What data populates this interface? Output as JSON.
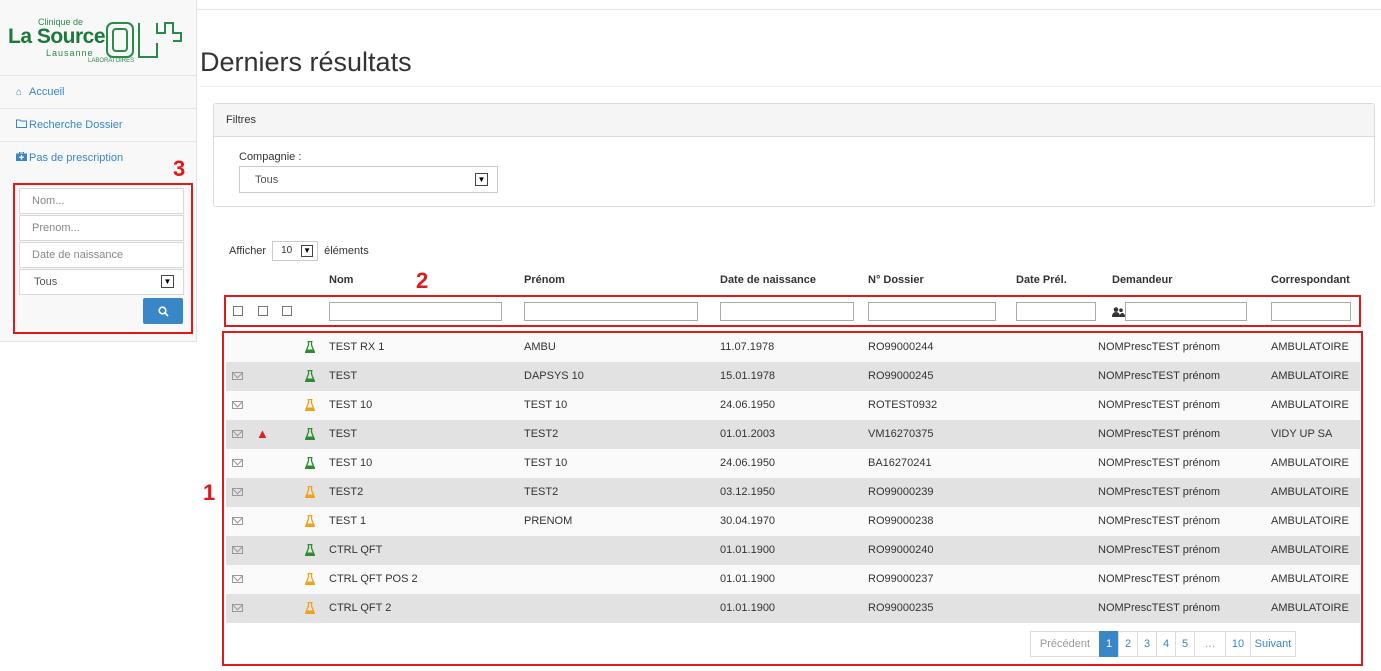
{
  "logo": {
    "line1": "Clinique de",
    "line2": "La Source",
    "line3": "Lausanne",
    "sub": "LABORATOIRES"
  },
  "sidebar": {
    "items": [
      {
        "label": "Accueil",
        "icon": "home-icon"
      },
      {
        "label": "Recherche Dossier",
        "icon": "folder-open-icon"
      },
      {
        "label": "Pas de prescription",
        "icon": "medkit-icon"
      }
    ],
    "search": {
      "nom_placeholder": "Nom...",
      "prenom_placeholder": "Prenom...",
      "dob_placeholder": "Date de naissance",
      "select_value": "Tous"
    }
  },
  "page": {
    "title": "Derniers résultats"
  },
  "filters": {
    "heading": "Filtres",
    "company_label": "Compagnie :",
    "company_value": "Tous"
  },
  "table": {
    "length_prefix": "Afficher",
    "length_value": "10",
    "length_suffix": "éléments",
    "headers": [
      "Nom",
      "Prénom",
      "Date de naissance",
      "N° Dossier",
      "Date Prél.",
      "Demandeur",
      "Correspondant"
    ],
    "rows": [
      {
        "mail": false,
        "warn": false,
        "flask": "green",
        "nom": "TEST RX 1",
        "prenom": "AMBU",
        "dob": "11.07.1978",
        "dossier": "RO99000244",
        "date_prel": "",
        "demandeur": "NOMPrescTEST prénom",
        "corr": "AMBULATOIRE"
      },
      {
        "mail": true,
        "warn": false,
        "flask": "green",
        "nom": "TEST",
        "prenom": "DAPSYS 10",
        "dob": "15.01.1978",
        "dossier": "RO99000245",
        "date_prel": "",
        "demandeur": "NOMPrescTEST prénom",
        "corr": "AMBULATOIRE"
      },
      {
        "mail": true,
        "warn": false,
        "flask": "orange",
        "nom": "TEST 10",
        "prenom": "TEST 10",
        "dob": "24.06.1950",
        "dossier": "ROTEST0932",
        "date_prel": "",
        "demandeur": "NOMPrescTEST prénom",
        "corr": "AMBULATOIRE"
      },
      {
        "mail": true,
        "warn": true,
        "flask": "green",
        "nom": "TEST",
        "prenom": "TEST2",
        "dob": "01.01.2003",
        "dossier": "VM16270375",
        "date_prel": "",
        "demandeur": "NOMPrescTEST prénom",
        "corr": "VIDY UP SA"
      },
      {
        "mail": true,
        "warn": false,
        "flask": "green",
        "nom": "TEST 10",
        "prenom": "TEST 10",
        "dob": "24.06.1950",
        "dossier": "BA16270241",
        "date_prel": "",
        "demandeur": "NOMPrescTEST prénom",
        "corr": "AMBULATOIRE"
      },
      {
        "mail": true,
        "warn": false,
        "flask": "orange",
        "nom": "TEST2",
        "prenom": "TEST2",
        "dob": "03.12.1950",
        "dossier": "RO99000239",
        "date_prel": "",
        "demandeur": "NOMPrescTEST prénom",
        "corr": "AMBULATOIRE"
      },
      {
        "mail": true,
        "warn": false,
        "flask": "orange",
        "nom": "TEST 1",
        "prenom": "PRENOM",
        "dob": "30.04.1970",
        "dossier": "RO99000238",
        "date_prel": "",
        "demandeur": "NOMPrescTEST prénom",
        "corr": "AMBULATOIRE"
      },
      {
        "mail": true,
        "warn": false,
        "flask": "green",
        "nom": "CTRL QFT",
        "prenom": "",
        "dob": "01.01.1900",
        "dossier": "RO99000240",
        "date_prel": "",
        "demandeur": "NOMPrescTEST prénom",
        "corr": "AMBULATOIRE"
      },
      {
        "mail": true,
        "warn": false,
        "flask": "orange",
        "nom": "CTRL QFT POS 2",
        "prenom": "",
        "dob": "01.01.1900",
        "dossier": "RO99000237",
        "date_prel": "",
        "demandeur": "NOMPrescTEST prénom",
        "corr": "AMBULATOIRE"
      },
      {
        "mail": true,
        "warn": false,
        "flask": "orange",
        "nom": "CTRL QFT 2",
        "prenom": "",
        "dob": "01.01.1900",
        "dossier": "RO99000235",
        "date_prel": "",
        "demandeur": "NOMPrescTEST prénom",
        "corr": "AMBULATOIRE"
      }
    ]
  },
  "pagination": {
    "prev": "Précédent",
    "pages": [
      "1",
      "2",
      "3",
      "4",
      "5",
      "…",
      "10"
    ],
    "active": "1",
    "next": "Suivant"
  },
  "annotations": [
    "1",
    "2",
    "3"
  ],
  "colors": {
    "accent": "#3a87c8",
    "annotation": "#e0191a",
    "flask_green": "#2e8b2e",
    "flask_orange": "#f0a01a",
    "warning": "#d9231c"
  }
}
